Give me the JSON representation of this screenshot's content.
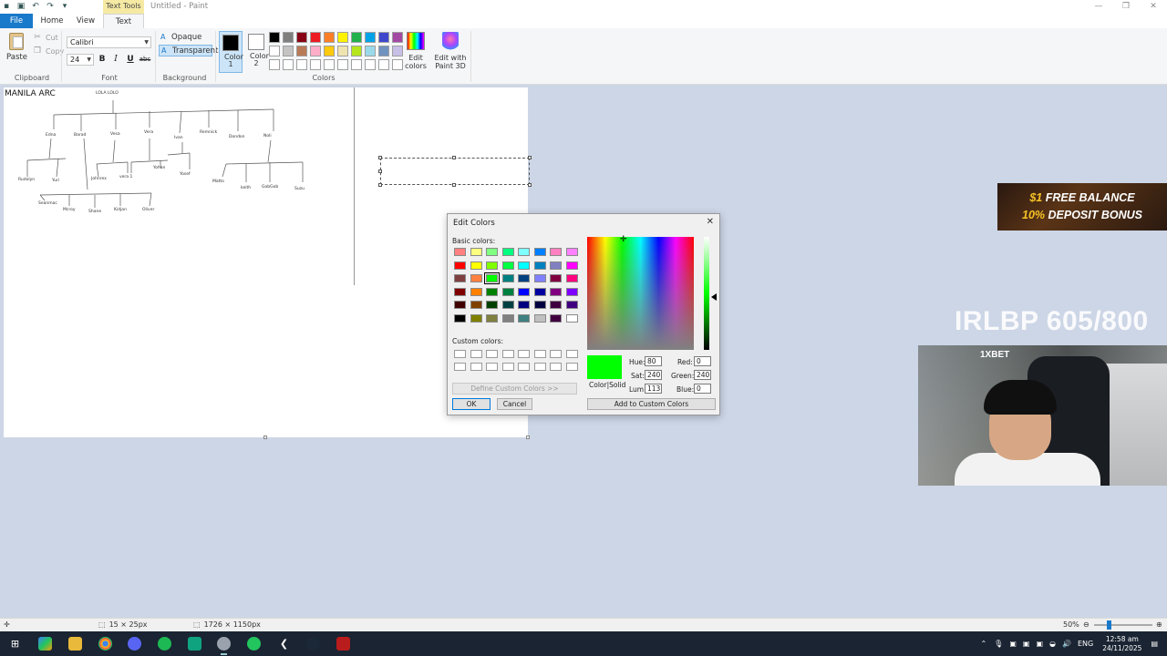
{
  "titlebar": {
    "context_tab": "Text Tools",
    "title": "Untitled - Paint"
  },
  "tabs": [
    "File",
    "Home",
    "View",
    "Text"
  ],
  "ribbon": {
    "clipboard": {
      "paste": "Paste",
      "cut": "Cut",
      "copy": "Copy",
      "label": "Clipboard"
    },
    "font": {
      "family": "Calibri",
      "size": "24",
      "bold": "B",
      "italic": "I",
      "underline": "U",
      "strike": "abc",
      "label": "Font"
    },
    "background": {
      "opaque": "Opaque",
      "transparent": "Transparent",
      "label": "Background"
    },
    "colors": {
      "color1_label": "Color 1",
      "color2_label": "Color 2",
      "color1": "#000000",
      "color2": "#ffffff",
      "edit_colors": "Edit colors",
      "edit_paint3d": "Edit with Paint 3D",
      "label": "Colors",
      "palette": [
        "#000000",
        "#7f7f7f",
        "#880015",
        "#ed1c24",
        "#ff7f27",
        "#fff200",
        "#22b14c",
        "#00a2e8",
        "#3f48cc",
        "#a349a4",
        "#ffffff",
        "#c3c3c3",
        "#b97a57",
        "#ffaec9",
        "#ffc90e",
        "#efe4b0",
        "#b5e61d",
        "#99d9ea",
        "#7092be",
        "#c8bfe7",
        "#ffffff",
        "#ffffff",
        "#ffffff",
        "#ffffff",
        "#ffffff",
        "#ffffff",
        "#ffffff",
        "#ffffff",
        "#ffffff",
        "#ffffff"
      ]
    }
  },
  "canvas": {
    "heading": "MANILA ARC",
    "root": "LOLA LOLO",
    "names": [
      "Edna",
      "Barad",
      "Vesa",
      "Vera",
      "Ivan",
      "Remnick",
      "Dondon",
      "Noli",
      "Rudolyn",
      "Yuri",
      "Johnrex",
      "vera 1",
      "Yohan",
      "Yosef",
      "Matto",
      "keith",
      "GobGob",
      "Suzu",
      "Seanmac",
      "Mcroy",
      "Shane",
      "Kidjan",
      "Oliver"
    ]
  },
  "dialog": {
    "title": "Edit Colors",
    "basic_label": "Basic colors:",
    "basic_colors": [
      "#ff8080",
      "#ffff80",
      "#80ff80",
      "#00ff80",
      "#80ffff",
      "#0080ff",
      "#ff80c0",
      "#ff80ff",
      "#ff0000",
      "#ffff00",
      "#80ff00",
      "#00ff40",
      "#00ffff",
      "#0080c0",
      "#8080c0",
      "#ff00ff",
      "#804040",
      "#ff8040",
      "#00ff00",
      "#008080",
      "#004080",
      "#8080ff",
      "#800040",
      "#ff0080",
      "#800000",
      "#ff8000",
      "#008000",
      "#008040",
      "#0000ff",
      "#0000a0",
      "#800080",
      "#8000ff",
      "#400000",
      "#804000",
      "#004000",
      "#004040",
      "#000080",
      "#000040",
      "#400040",
      "#400080",
      "#000000",
      "#808000",
      "#808040",
      "#808080",
      "#408080",
      "#c0c0c0",
      "#400040",
      "#ffffff"
    ],
    "selected_index": 18,
    "custom_label": "Custom colors:",
    "define_custom": "Define Custom Colors >>",
    "ok": "OK",
    "cancel": "Cancel",
    "color_solid": "Color|Solid",
    "hue_label": "Hue:",
    "hue": "80",
    "sat_label": "Sat:",
    "sat": "240",
    "lum_label": "Lum:",
    "lum": "113",
    "red_label": "Red:",
    "red": "0",
    "green_label": "Green:",
    "green": "240",
    "blue_label": "Blue:",
    "blue": "0",
    "add_custom": "Add to Custom Colors",
    "preview_color": "#00ff00"
  },
  "overlay": {
    "ad_line1_hi": "$1",
    "ad_line1": " FREE BALANCE",
    "ad_line2_hi": "10%",
    "ad_line2": " DEPOSIT BONUS",
    "counter": "IRLBP 605/800",
    "webcam_logo": "1XBET"
  },
  "statusbar": {
    "selection_size": "15 × 25px",
    "image_size": "1726 × 1150px",
    "zoom": "50%"
  },
  "taskbar": {
    "lang": "ENG",
    "time": "12:58 am",
    "date": "24/11/2025"
  }
}
